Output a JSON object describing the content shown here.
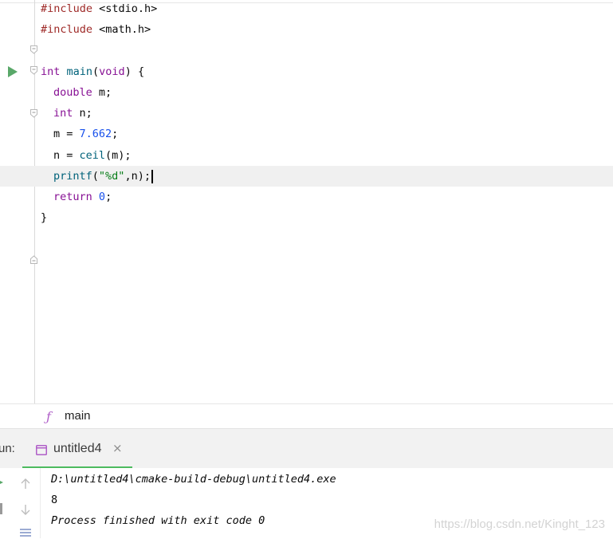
{
  "editor": {
    "lines": {
      "l1": {
        "directive": "#include",
        "arg": " <stdio.h>"
      },
      "l2": {
        "directive": "#include",
        "arg": " <math.h>"
      },
      "l4": {
        "type": "int",
        "fn": " main",
        "paren_open": "(",
        "param": "void",
        "rest": ") {"
      },
      "l5": {
        "type": "double",
        "rest": " m;"
      },
      "l6": {
        "type": "int",
        "rest": " n;"
      },
      "l7": {
        "lhs": "m = ",
        "num": "7.662",
        "rest": ";"
      },
      "l8": {
        "lhs": "n = ",
        "fn": "ceil",
        "rest": "(m);"
      },
      "l9": {
        "fn": "printf",
        "open": "(",
        "str": "\"%d\"",
        "rest": ",n);"
      },
      "l10": {
        "kw": "return",
        "space": " ",
        "num": "0",
        "rest": ";"
      },
      "l11": {
        "brace": "}"
      }
    }
  },
  "breadcrumb": {
    "icon": "ƒ",
    "label": "main"
  },
  "run_panel": {
    "label": "un:",
    "tab": {
      "label": "untitled4",
      "close": "×"
    }
  },
  "console": {
    "path": "D:\\untitled4\\cmake-build-debug\\untitled4.exe",
    "output": "8",
    "exit_message": "Process finished with exit code 0"
  },
  "watermark": "https://blog.csdn.net/Kinght_123",
  "colors": {
    "run_accent": "#4dbb5f",
    "function_icon": "#b05fc8",
    "current_line": "#f0f0f0"
  },
  "icons": {
    "run_gutter": "play-icon",
    "tab": "window-icon",
    "up": "arrow-up-icon",
    "down": "arrow-down-icon",
    "stop": "stop-icon",
    "wrap": "soft-wrap-icon"
  }
}
